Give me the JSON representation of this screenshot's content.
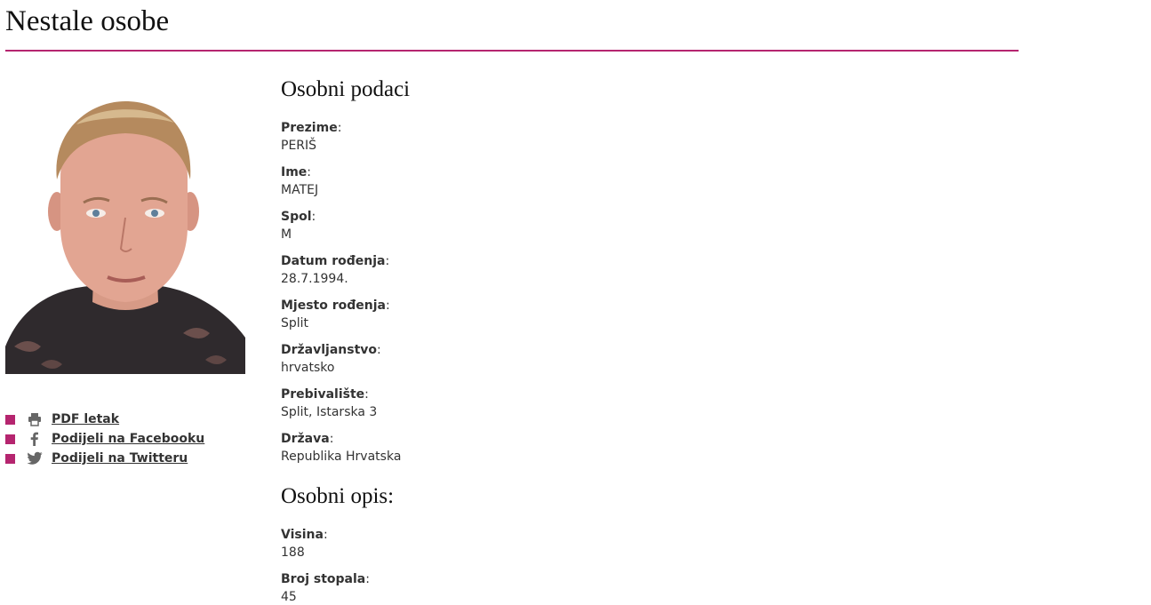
{
  "page": {
    "title": "Nestale osobe"
  },
  "colors": {
    "accent": "#b5256f"
  },
  "share": {
    "items": [
      {
        "label": "PDF letak",
        "icon": "printer-icon"
      },
      {
        "label": "Podijeli na Facebooku",
        "icon": "facebook-icon"
      },
      {
        "label": "Podijeli na Twitteru",
        "icon": "twitter-icon"
      }
    ]
  },
  "personal": {
    "heading": "Osobni podaci",
    "fields": [
      {
        "label": "Prezime",
        "value": "PERIŠ"
      },
      {
        "label": "Ime",
        "value": "MATEJ"
      },
      {
        "label": "Spol",
        "value": "M"
      },
      {
        "label": "Datum rođenja",
        "value": "28.7.1994."
      },
      {
        "label": "Mjesto rođenja",
        "value": "Split"
      },
      {
        "label": "Državljanstvo",
        "value": "hrvatsko"
      },
      {
        "label": "Prebivalište",
        "value": "Split, Istarska 3"
      },
      {
        "label": "Država",
        "value": "Republika Hrvatska"
      }
    ]
  },
  "description": {
    "heading": "Osobni opis:",
    "fields": [
      {
        "label": "Visina",
        "value": "188"
      },
      {
        "label": "Broj stopala",
        "value": "45"
      }
    ]
  }
}
